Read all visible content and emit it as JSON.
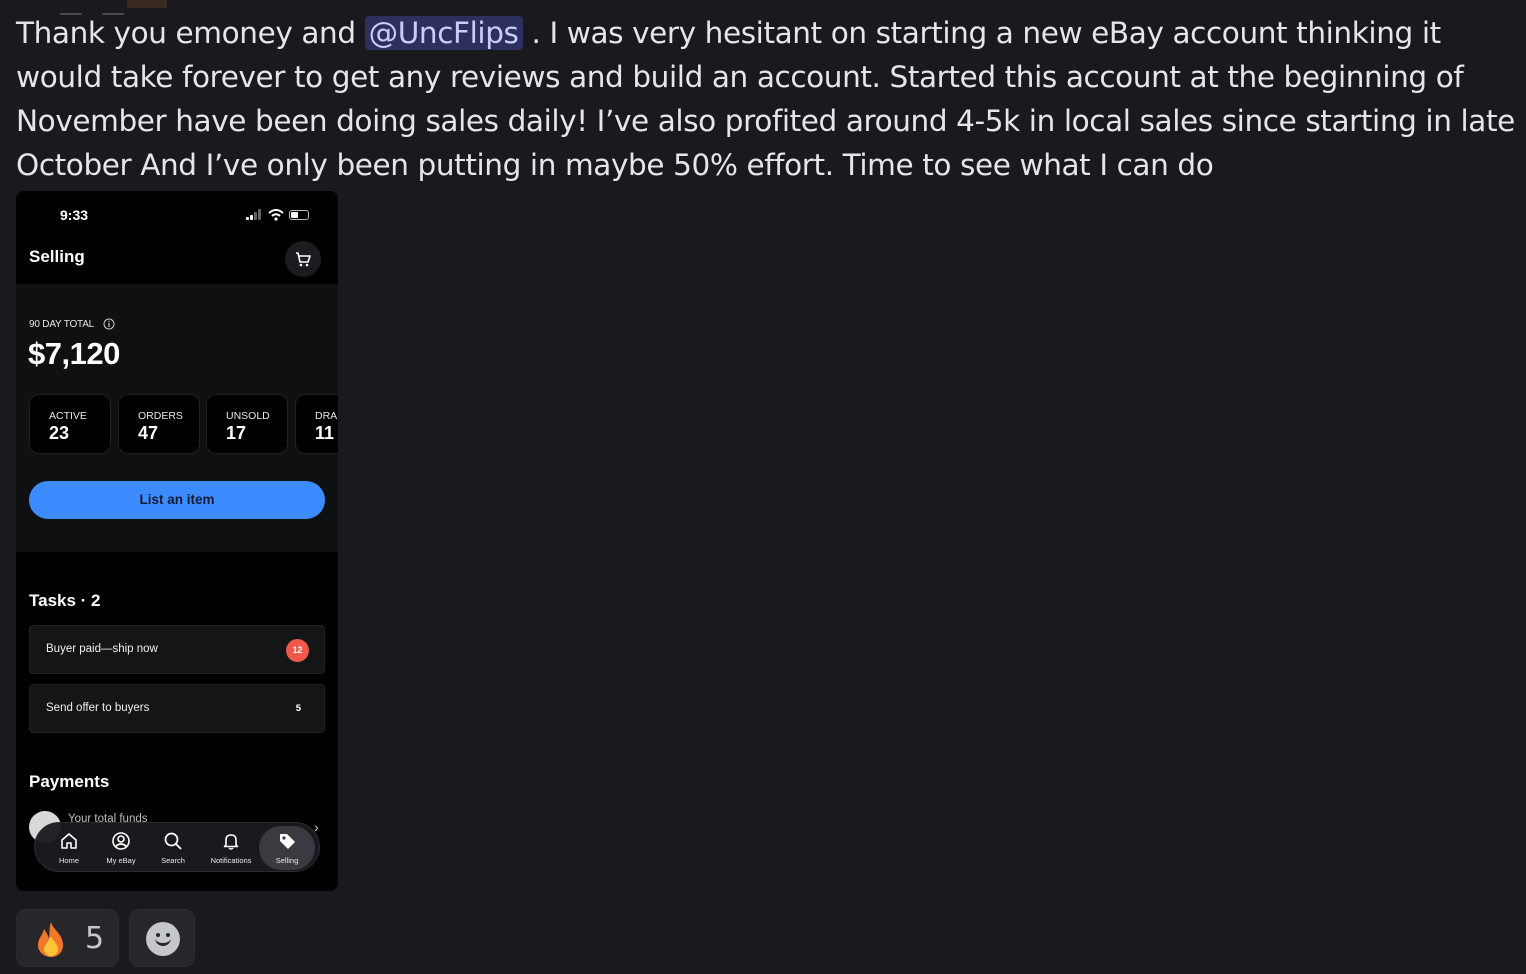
{
  "message": {
    "before_mention": "Thank you emoney and ",
    "mention": "@UncFlips",
    "after_mention": " . I was very hesitant on starting a new eBay account thinking it would take forever to get any reviews and build an account. Started this account at the beginning of November have been doing sales daily! I’ve also profited around 4-5k in local sales since starting in late October And I’ve only been putting in maybe 50% effort. Time to see what I can do"
  },
  "phone": {
    "status_time": "9:33",
    "title": "Selling",
    "total_label": "90 DAY TOTAL",
    "total_value": "$7,120",
    "stats": [
      {
        "label": "ACTIVE",
        "value": "23"
      },
      {
        "label": "ORDERS",
        "value": "47"
      },
      {
        "label": "UNSOLD",
        "value": "17"
      },
      {
        "label": "DRAI",
        "value": "11"
      }
    ],
    "list_button": "List an item",
    "tasks_title": "Tasks · 2",
    "tasks": [
      {
        "label": "Buyer paid—ship now",
        "count": "12"
      },
      {
        "label": "Send offer to buyers",
        "count": "5"
      }
    ],
    "payments_title": "Payments",
    "funds_label": "Your total funds",
    "tabs": [
      "Home",
      "My eBay",
      "Search",
      "Notifications",
      "Selling"
    ],
    "active_tab": "Selling",
    "colors": {
      "accent": "#3d8cff",
      "badge": "#f0584a"
    }
  },
  "reactions": {
    "fire_icon": "fire-emoji",
    "fire_count": "5",
    "add_reaction_icon": "smiley-icon"
  }
}
